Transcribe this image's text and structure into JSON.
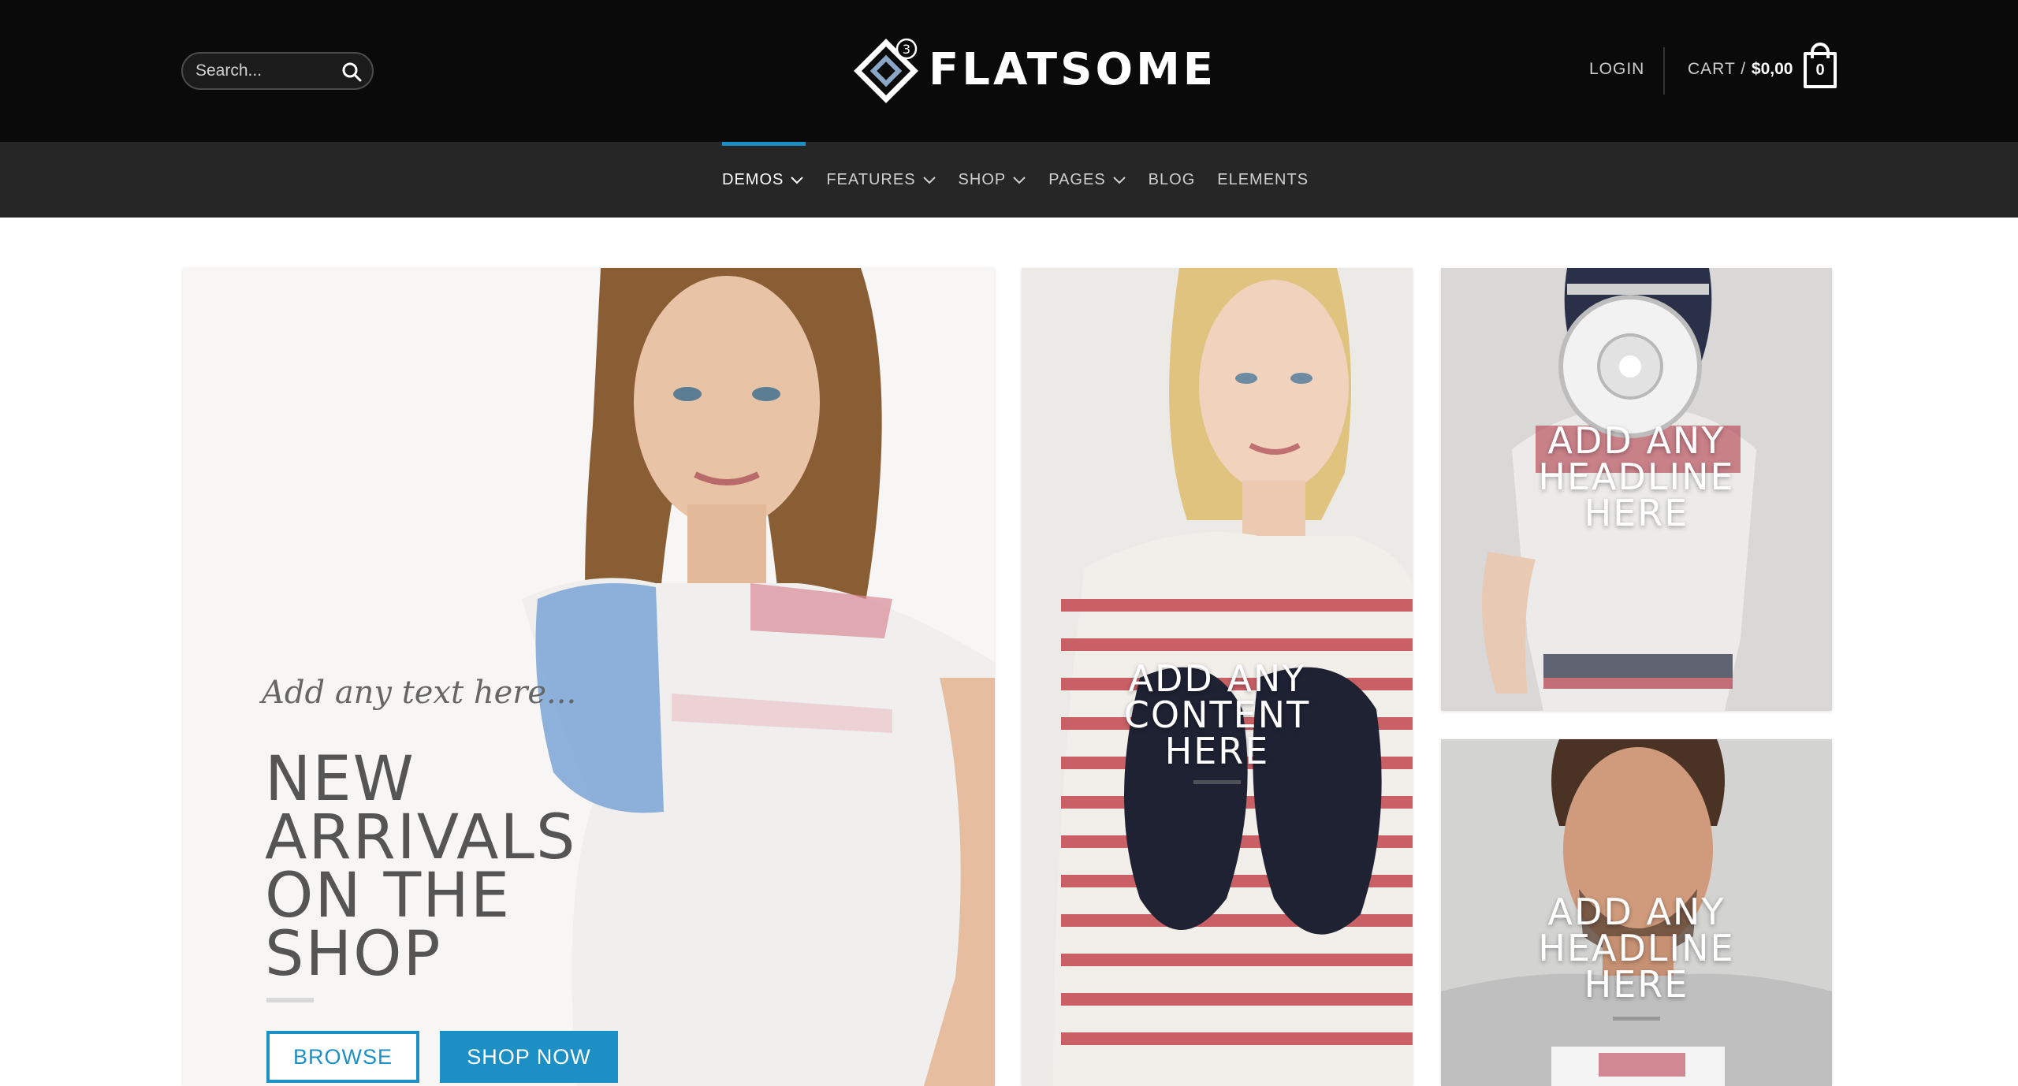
{
  "header": {
    "search_placeholder": "Search...",
    "logo_text": "FLATSOME",
    "logo_version": "3",
    "login_label": "LOGIN",
    "cart_label": "CART /",
    "cart_amount": "$0,00",
    "cart_count": "0"
  },
  "nav": {
    "items": [
      {
        "label": "DEMOS",
        "dropdown": true,
        "active": true
      },
      {
        "label": "FEATURES",
        "dropdown": true
      },
      {
        "label": "SHOP",
        "dropdown": true
      },
      {
        "label": "PAGES",
        "dropdown": true
      },
      {
        "label": "BLOG",
        "dropdown": false
      },
      {
        "label": "ELEMENTS",
        "dropdown": false
      }
    ]
  },
  "hero": {
    "tagline": "Add any text here...",
    "title_lines": [
      "NEW",
      "ARRIVALS",
      "ON THE",
      "SHOP"
    ],
    "browse_label": "BROWSE",
    "shop_label": "SHOP NOW"
  },
  "banner_content": {
    "lines": [
      "ADD ANY",
      "CONTENT",
      "HERE"
    ]
  },
  "banner_headline_top": {
    "lines": [
      "ADD ANY",
      "HEADLINE",
      "HERE"
    ]
  },
  "banner_headline_bottom": {
    "lines": [
      "ADD ANY",
      "HEADLINE",
      "HERE"
    ]
  },
  "colors": {
    "accent": "#1c8fc4",
    "header_bg": "#0a0a0a",
    "nav_bg": "#262626"
  }
}
